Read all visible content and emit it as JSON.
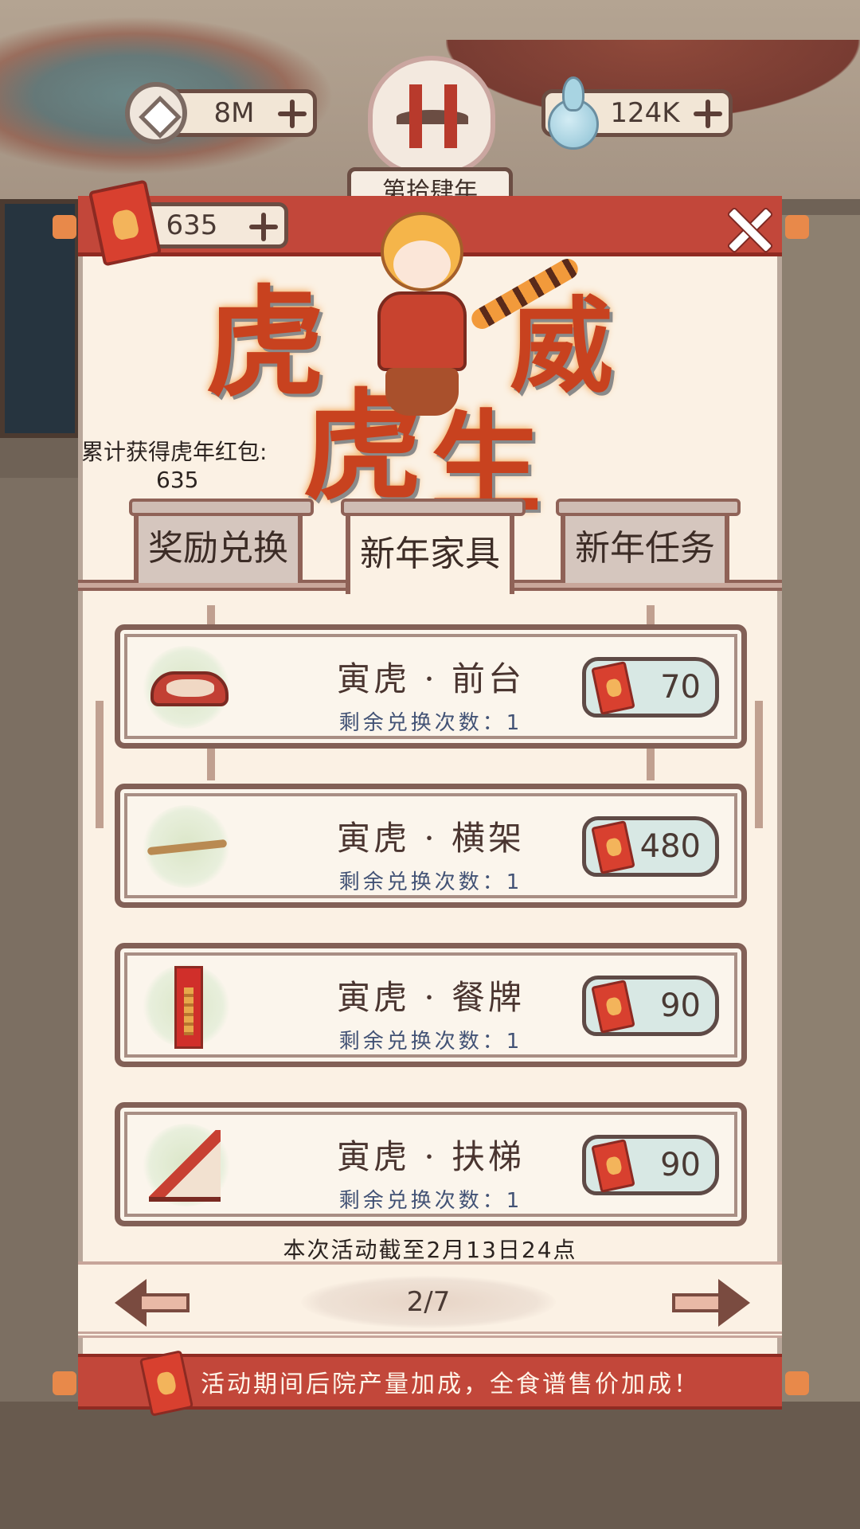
{
  "resources": {
    "coins": "8M",
    "water": "124K",
    "envelopes": "635"
  },
  "year_banner": "第拾肆年",
  "title_art": {
    "chars": [
      "虎",
      "威",
      "虎",
      "生"
    ]
  },
  "accumulated": {
    "label": "累计获得虎年红包:",
    "value": "635"
  },
  "tabs": [
    {
      "label": "奖励兑换",
      "active": false
    },
    {
      "label": "新年家具",
      "active": true
    },
    {
      "label": "新年任务",
      "active": false
    }
  ],
  "items": [
    {
      "name": "寅虎 · 前台",
      "remaining": "剩余兑换次数：1",
      "price": "70",
      "icon": "counter-icon"
    },
    {
      "name": "寅虎 · 横架",
      "remaining": "剩余兑换次数：1",
      "price": "480",
      "icon": "rod-icon"
    },
    {
      "name": "寅虎 · 餐牌",
      "remaining": "剩余兑换次数：1",
      "price": "90",
      "icon": "menu-sign-icon"
    },
    {
      "name": "寅虎 · 扶梯",
      "remaining": "剩余兑换次数：1",
      "price": "90",
      "icon": "stairs-icon"
    }
  ],
  "deadline": "本次活动截至2月13日24点",
  "pagination": {
    "current": 2,
    "total": 7,
    "label": "2/7"
  },
  "footer": {
    "text": "活动期间后院产量加成，全食谱售价加成！"
  },
  "colors": {
    "accent_red": "#c2473a",
    "panel_bg": "#fbf1e4",
    "border_brown": "#826056",
    "price_bg": "#d8e8e4"
  }
}
